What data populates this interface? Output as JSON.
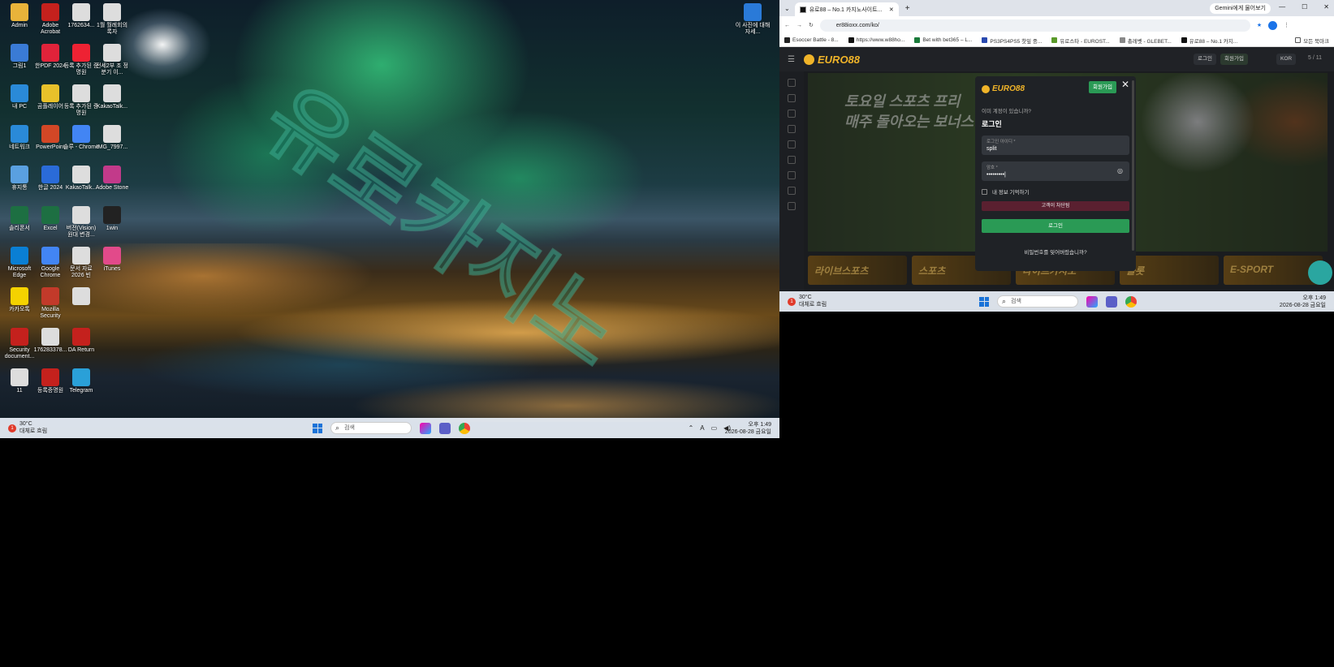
{
  "desktop": {
    "icons": [
      {
        "label": "Admin"
      },
      {
        "label": "Adobe Acrobat"
      },
      {
        "label": "1762634..."
      },
      {
        "label": "1월 월례회의 록자"
      },
      {
        "label": "그림1"
      },
      {
        "label": "한PDF 2024"
      },
      {
        "label": "등록 추가된 증명원"
      },
      {
        "label": "전세2부 조 정분기 이..."
      },
      {
        "label": "내 PC"
      },
      {
        "label": "곰플레이어"
      },
      {
        "label": "등록 추가된 증명원"
      },
      {
        "label": "KakaoTalk..."
      },
      {
        "label": "네트워크"
      },
      {
        "label": "PowerPoint"
      },
      {
        "label": "솔루 - Chrome"
      },
      {
        "label": "IMG_7997..."
      },
      {
        "label": "휴지통"
      },
      {
        "label": "한글 2024"
      },
      {
        "label": "KakaoTalk..."
      },
      {
        "label": "Adobe Stone"
      },
      {
        "label": "솔리폰서"
      },
      {
        "label": "Excel"
      },
      {
        "label": "버전(Vision) 원대 변경..."
      },
      {
        "label": "1win"
      },
      {
        "label": "Microsoft Edge"
      },
      {
        "label": "Google Chrome"
      },
      {
        "label": "문서 자료 2026 빈"
      },
      {
        "label": "iTunes"
      },
      {
        "label": "카카오톡"
      },
      {
        "label": "Mozilla Security"
      },
      {
        "label": ""
      },
      {
        "label": "Security document..."
      },
      {
        "label": "176283378..."
      },
      {
        "label": "DA Return"
      },
      {
        "label": "11"
      },
      {
        "label": "등록증명원"
      },
      {
        "label": "Telegram"
      },
      {
        "label": "이 사진에 대해 자세..."
      }
    ]
  },
  "taskbar_left": {
    "temp": "30°C",
    "weather": "대체로 흐림",
    "search_placeholder": "검색",
    "time": "오후 1:49",
    "date": "2026-08-28 금요일"
  },
  "taskbar_right": {
    "temp": "30°C",
    "weather": "대체로 흐림",
    "search_placeholder": "검색",
    "time": "오후 1:49",
    "date": "2026-08-28 금요일"
  },
  "browser": {
    "tab_title": "유로88 – No.1 카지노사이트...",
    "new_tab": "+",
    "gemini_label": "Gemini에게 물어보기",
    "url": "er88ioxx.com/ko/",
    "bookmarks": [
      "Esoccer Battle - 8...",
      "https://www.w88ho...",
      "Bet with bet365 – L...",
      "PS3PS4PS5 찻잎 중...",
      "유로스타 - EUROST...",
      "총레벳 - GLEBET...",
      "유로88 – No.1 카지..."
    ],
    "all_bookmarks": "모든 북마크"
  },
  "site": {
    "logo": "EURO88",
    "header_login": "로그인",
    "header_signup": "회원가입",
    "lang": "KOR",
    "banner_line1": "토요일 스포츠 프리",
    "banner_line2": "매주 돌아오는 보너스",
    "slide_count": "5 / 11",
    "categories": [
      "라이브스포츠",
      "스포츠",
      "라이브카지노",
      "슬롯",
      "E-SPORT"
    ]
  },
  "login_modal": {
    "logo": "EURO88",
    "signup_button": "회원가입",
    "close": "✕",
    "question": "이미 계정이 있습니까?",
    "heading": "로그인",
    "id_label": "로그인 아이디 *",
    "id_value": "split",
    "pw_label": "암호 *",
    "pw_value": "•••••••••|",
    "remember": "내 정보 기억하기",
    "alert": "고객이 차단됨",
    "login_button": "로그인",
    "forgot": "비밀번호를 잊어버렸습니까?"
  },
  "watermark": "유로카지노",
  "colors": {
    "accent": "#2a9a55",
    "brand": "#f0b429",
    "alert": "#5a2030"
  }
}
